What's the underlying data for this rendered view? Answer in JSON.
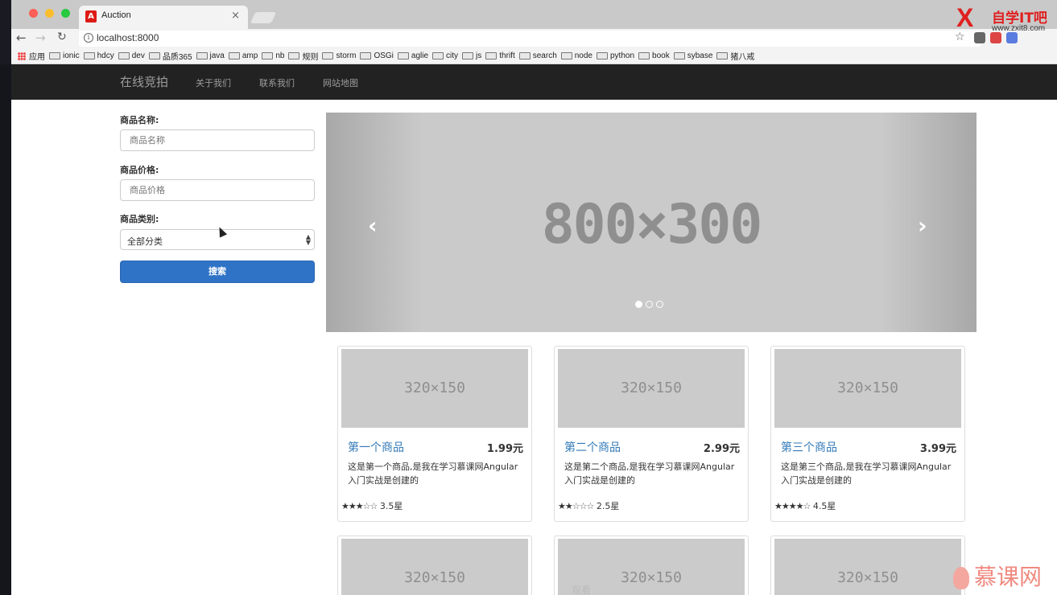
{
  "browser": {
    "tab_title": "Auction",
    "tab_close": "×",
    "url": "localhost:8000",
    "bookmarks": [
      {
        "label": "应用",
        "type": "apps"
      },
      {
        "label": "ionic"
      },
      {
        "label": "hdcy"
      },
      {
        "label": "dev"
      },
      {
        "label": "品质365"
      },
      {
        "label": "java"
      },
      {
        "label": "amp"
      },
      {
        "label": "nb"
      },
      {
        "label": "规则"
      },
      {
        "label": "storm"
      },
      {
        "label": "OSGi"
      },
      {
        "label": "aglie"
      },
      {
        "label": "city"
      },
      {
        "label": "js"
      },
      {
        "label": "thrift"
      },
      {
        "label": "search"
      },
      {
        "label": "node"
      },
      {
        "label": "python"
      },
      {
        "label": "book"
      },
      {
        "label": "sybase"
      },
      {
        "label": "猪八戒"
      }
    ]
  },
  "watermark": {
    "mark": "X",
    "title": "自学IT吧",
    "url": "www.zxit8.com"
  },
  "navbar": {
    "brand": "在线竞拍",
    "links": [
      "关于我们",
      "联系我们",
      "网站地图"
    ]
  },
  "search_form": {
    "name_label": "商品名称:",
    "name_placeholder": "商品名称",
    "price_label": "商品价格:",
    "price_placeholder": "商品价格",
    "category_label": "商品类别:",
    "category_value": "全部分类",
    "submit_label": "搜索"
  },
  "carousel": {
    "image_text": "800×300",
    "prev": "‹",
    "next": "›",
    "slide_count": 3,
    "active_slide": 0
  },
  "products": [
    {
      "title": "第一个商品",
      "price": "1.99元",
      "desc": "这是第一个商品,是我在学习慕课网Angular入门实战是创建的",
      "rating": 3.5,
      "rating_label": "3.5星",
      "thumb": "320×150"
    },
    {
      "title": "第二个商品",
      "price": "2.99元",
      "desc": "这是第二个商品,是我在学习慕课网Angular入门实战是创建的",
      "rating": 2.5,
      "rating_label": "2.5星",
      "thumb": "320×150"
    },
    {
      "title": "第三个商品",
      "price": "3.99元",
      "desc": "这是第三个商品,是我在学习慕课网Angular入门实战是创建的",
      "rating": 4.5,
      "rating_label": "4.5星",
      "thumb": "320×150"
    }
  ],
  "products_row2": [
    {
      "thumb": "320×150"
    },
    {
      "thumb": "320×150"
    },
    {
      "thumb": "320×150"
    }
  ],
  "overlay": {
    "faint_text": "观看",
    "bottom_logo": "慕课网"
  },
  "colors": {
    "navbar_bg": "#222222",
    "primary_button": "#2f73c6",
    "link": "#337ab7"
  }
}
